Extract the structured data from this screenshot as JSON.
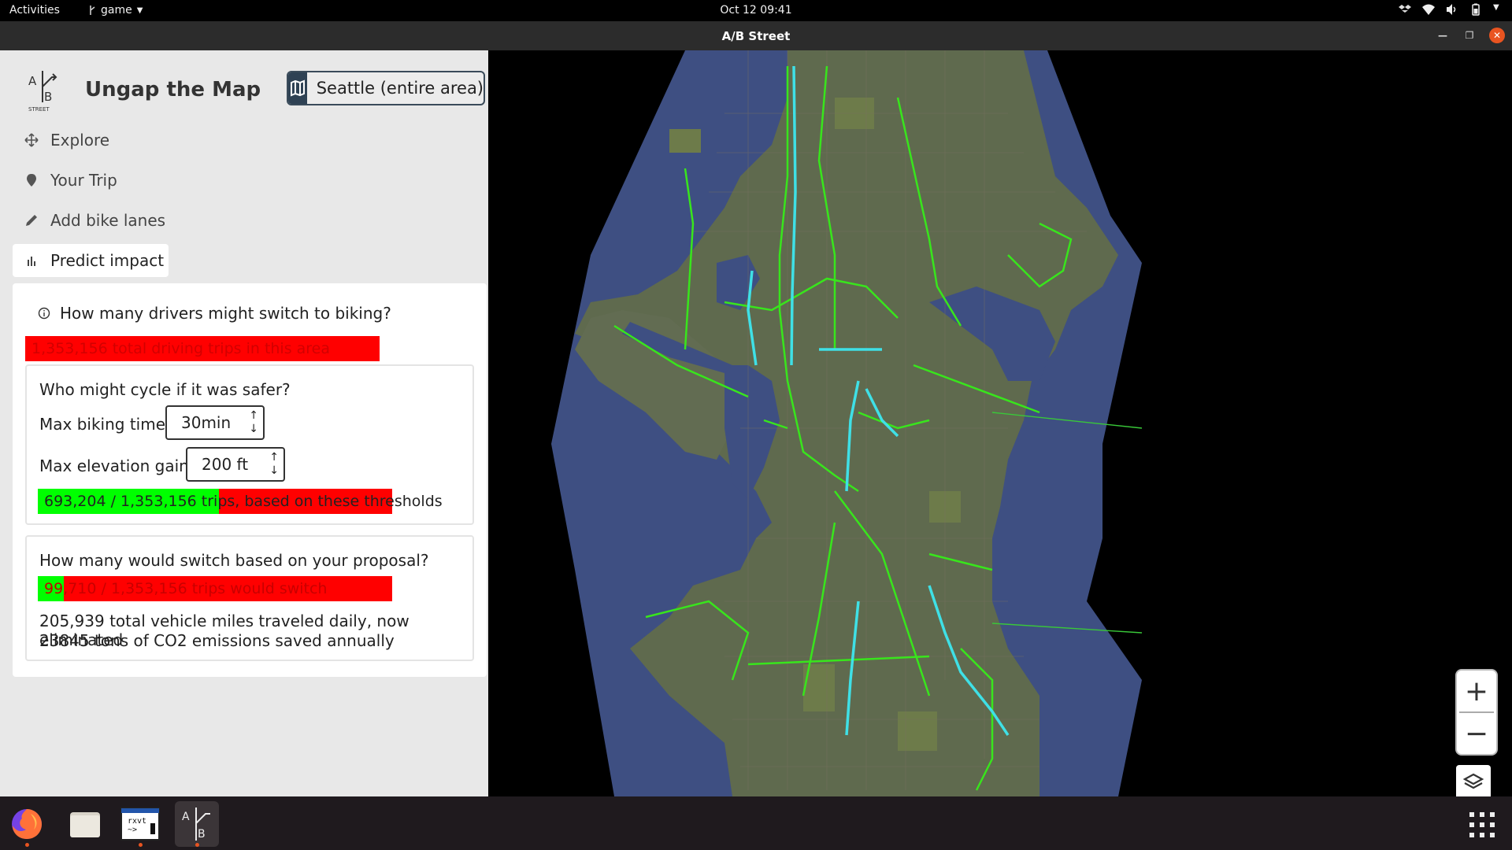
{
  "topbar": {
    "activities": "Activities",
    "app_menu": "game",
    "clock": "Oct 12  09:41"
  },
  "window": {
    "title": "A/B Street"
  },
  "panel": {
    "app_title": "Ungap the Map",
    "map_selector": "Seattle (entire area)",
    "nav": [
      {
        "label": "Explore",
        "icon": "move-icon"
      },
      {
        "label": "Your Trip",
        "icon": "pin-icon"
      },
      {
        "label": "Add bike lanes",
        "icon": "pencil-icon"
      },
      {
        "label": "Predict impact",
        "icon": "chart-icon",
        "active": true
      }
    ],
    "impact": {
      "question": "How many drivers might switch to biking?",
      "total_trips_bar": "1,353,156 total driving trips in this area",
      "safer": {
        "heading": "Who might cycle if it was safer?",
        "max_biking_time_label": "Max biking time",
        "max_biking_time_value": "30min",
        "max_elevation_label": "Max elevation gain",
        "max_elevation_value": "200 ft",
        "thresholds_bar": "693,204 / 1,353,156 trips, based on these thresholds",
        "thresholds_fraction": 0.512
      },
      "proposal": {
        "heading": "How many would switch based on your proposal?",
        "switch_bar": "99,710 / 1,353,156 trips would switch",
        "switch_fraction": 0.074,
        "vmt": "205,939 total vehicle miles traveled daily, now eliminated",
        "co2": "23845 tons of CO2 emissions saved annually"
      }
    }
  },
  "map": {
    "zoom_in": "+",
    "zoom_out": "−"
  },
  "taskbar": {
    "rxvt_label": "rxvt",
    "rxvt_prompt": "~>"
  },
  "colors": {
    "water": "#3e4f82",
    "land": "#5f6a4e",
    "bike_green": "#38e51c",
    "bike_cyan": "#3fe0e6",
    "accent": "#e95420",
    "bar_red": "#ff0000",
    "bar_green": "#00ff00"
  }
}
